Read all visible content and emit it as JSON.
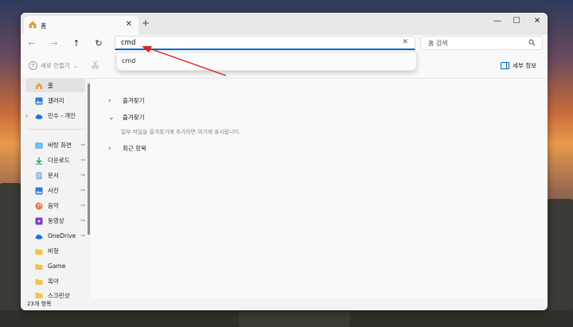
{
  "window": {
    "tab_title": "홈",
    "tab_close": "✕",
    "new_tab": "+",
    "minimize": "—",
    "maximize": "☐",
    "close": "✕"
  },
  "nav": {
    "back": "←",
    "forward": "→",
    "up": "↑",
    "refresh": "↻",
    "address_value": "cmd",
    "address_clear": "✕",
    "search_placeholder": "홈 검색"
  },
  "toolbar": {
    "new_label": "새로 만들기",
    "new_arrow": "⌄",
    "details_label": "세부 정보"
  },
  "dropdown": {
    "suggestion": "cmd"
  },
  "sidebar": {
    "items": [
      {
        "label": "홈",
        "icon": "home-icon"
      },
      {
        "label": "갤러리",
        "icon": "gallery-icon"
      },
      {
        "label": "민수 - 개인",
        "icon": "onedrive-icon"
      },
      {
        "label": "바탕 화면",
        "icon": "desktop-icon"
      },
      {
        "label": "다운로드",
        "icon": "download-icon"
      },
      {
        "label": "문서",
        "icon": "document-icon"
      },
      {
        "label": "사진",
        "icon": "pictures-icon"
      },
      {
        "label": "음악",
        "icon": "music-icon"
      },
      {
        "label": "동영상",
        "icon": "video-icon"
      },
      {
        "label": "OneDrive",
        "icon": "onedrive-icon"
      },
      {
        "label": "비헝",
        "icon": "folder-icon"
      },
      {
        "label": "Game",
        "icon": "folder-icon"
      },
      {
        "label": "혹야",
        "icon": "folder-icon"
      },
      {
        "label": "스크린샷",
        "icon": "folder-icon"
      }
    ],
    "pin_glyph": "📌",
    "expand_glyph": "›"
  },
  "content": {
    "sections": [
      {
        "title": "즐겨찾기",
        "state": "collapsed",
        "chevron": "›"
      },
      {
        "title": "즐겨찾기",
        "state": "expanded",
        "chevron": "⌄"
      },
      {
        "title": "최근 항목",
        "state": "collapsed",
        "chevron": "›"
      }
    ],
    "empty_message": "일부 파일을 즐겨찾기에 추가하면 여기에 표시됩니다."
  },
  "status": {
    "item_count": "23개 항목"
  },
  "colors": {
    "accent": "#0067c0",
    "annotation_arrow": "#e02020"
  }
}
